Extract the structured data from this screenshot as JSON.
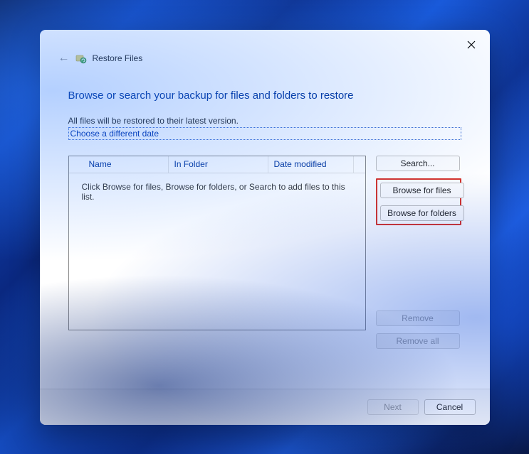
{
  "appTitle": "Restore Files",
  "heading": "Browse or search your backup for files and folders to restore",
  "introText": "All files will be restored to their latest version.",
  "dateLink": "Choose a different date",
  "table": {
    "columns": {
      "name": "Name",
      "folder": "In Folder",
      "date": "Date modified"
    },
    "placeholder": "Click Browse for files, Browse for folders, or Search to add files to this list."
  },
  "buttons": {
    "search": "Search...",
    "browseFiles": "Browse for files",
    "browseFolders": "Browse for folders",
    "remove": "Remove",
    "removeAll": "Remove all",
    "next": "Next",
    "cancel": "Cancel"
  }
}
